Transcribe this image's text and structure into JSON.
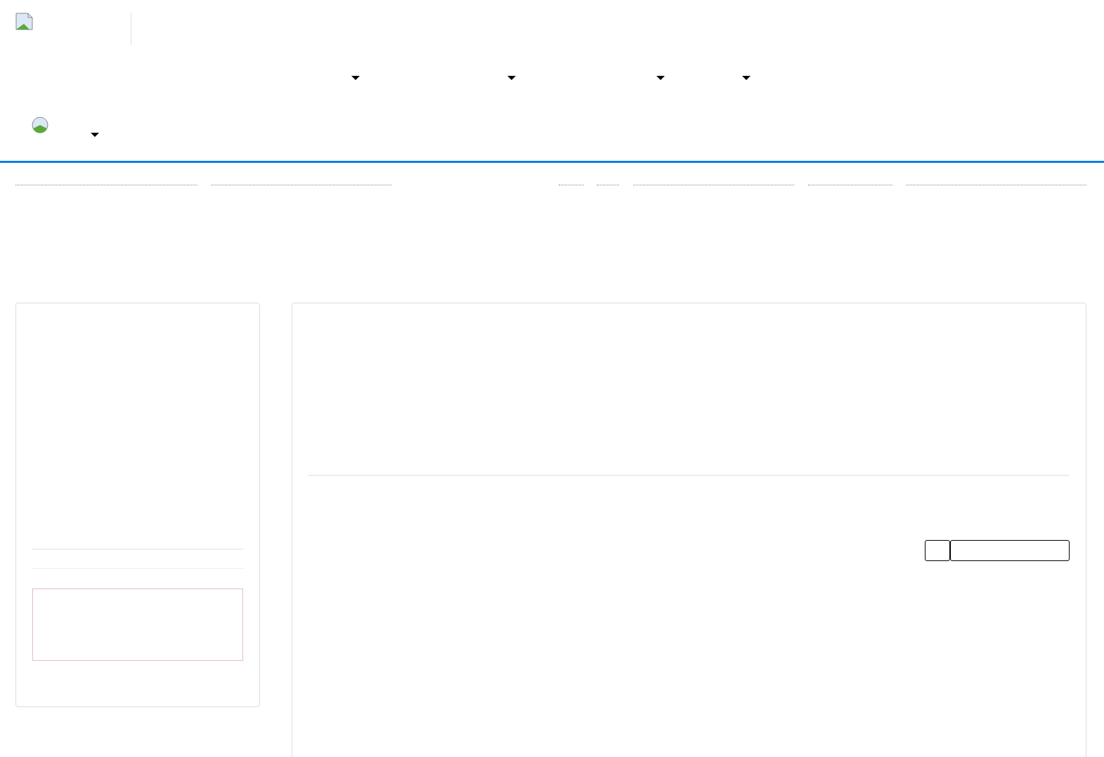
{
  "header": {
    "logo": {
      "kind": "broken-image"
    }
  },
  "nav_menus": [
    {
      "kind": "dropdown"
    },
    {
      "kind": "dropdown"
    },
    {
      "kind": "dropdown"
    },
    {
      "kind": "dropdown"
    }
  ],
  "user_menu": {
    "avatar": {
      "kind": "broken-image"
    },
    "kind": "dropdown"
  },
  "links": [
    {
      "kind": "dotted"
    },
    {
      "kind": "dotted"
    },
    {
      "kind": "dotted"
    },
    {
      "kind": "dotted"
    },
    {
      "kind": "dotted"
    },
    {
      "kind": "dotted"
    },
    {
      "kind": "dotted"
    }
  ],
  "sidebar": {
    "alert": {
      "kind": "alert"
    }
  },
  "main": {
    "buttons": [
      {
        "kind": "small"
      },
      {
        "kind": "wide"
      }
    ]
  }
}
